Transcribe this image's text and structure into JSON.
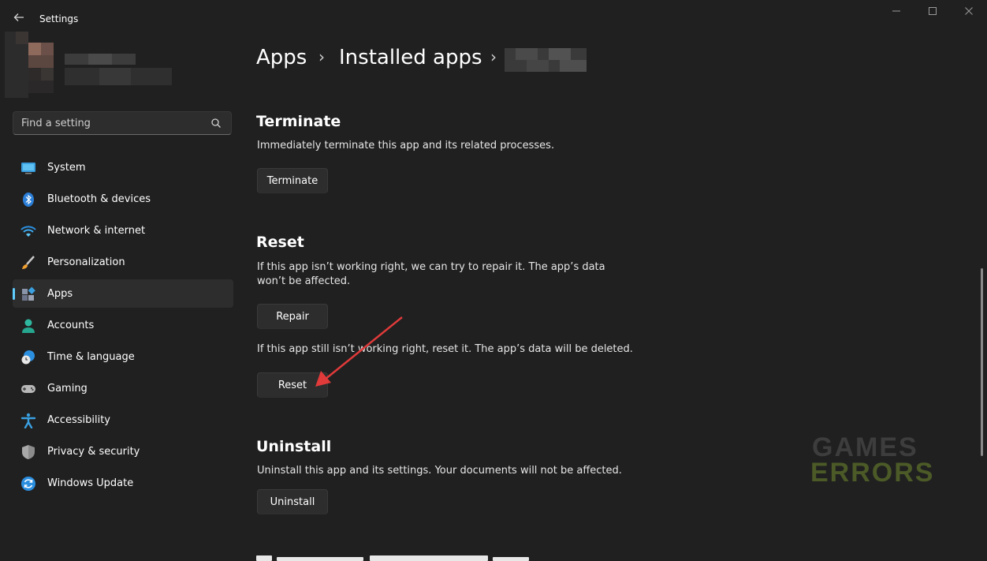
{
  "window": {
    "title": "Settings"
  },
  "search": {
    "placeholder": "Find a setting"
  },
  "nav": [
    {
      "label": "System",
      "icon": "system-icon"
    },
    {
      "label": "Bluetooth & devices",
      "icon": "bluetooth-icon"
    },
    {
      "label": "Network & internet",
      "icon": "wifi-icon"
    },
    {
      "label": "Personalization",
      "icon": "brush-icon"
    },
    {
      "label": "Apps",
      "icon": "apps-icon",
      "active": true
    },
    {
      "label": "Accounts",
      "icon": "person-icon"
    },
    {
      "label": "Time & language",
      "icon": "clock-globe-icon"
    },
    {
      "label": "Gaming",
      "icon": "gamepad-icon"
    },
    {
      "label": "Accessibility",
      "icon": "accessibility-icon"
    },
    {
      "label": "Privacy & security",
      "icon": "shield-icon"
    },
    {
      "label": "Windows Update",
      "icon": "update-icon"
    }
  ],
  "breadcrumb": {
    "level1": "Apps",
    "level2": "Installed apps"
  },
  "terminate": {
    "heading": "Terminate",
    "desc": "Immediately terminate this app and its related processes.",
    "button": "Terminate"
  },
  "reset": {
    "heading": "Reset",
    "repair_desc_line1": "If this app isn’t working right, we can try to repair it. The app’s data",
    "repair_desc_line2": "won’t be affected.",
    "repair_button": "Repair",
    "reset_desc": "If this app still isn’t working right, reset it. The app’s data will be deleted.",
    "reset_button": "Reset"
  },
  "uninstall": {
    "heading": "Uninstall",
    "desc": "Uninstall this app and its settings. Your documents will not be affected.",
    "button": "Uninstall"
  },
  "watermark": {
    "line1": "GAMES",
    "line2": "ERRORS"
  },
  "colors": {
    "accent": "#60cdff",
    "background": "#202020",
    "annotation_arrow": "#e03a3a"
  }
}
